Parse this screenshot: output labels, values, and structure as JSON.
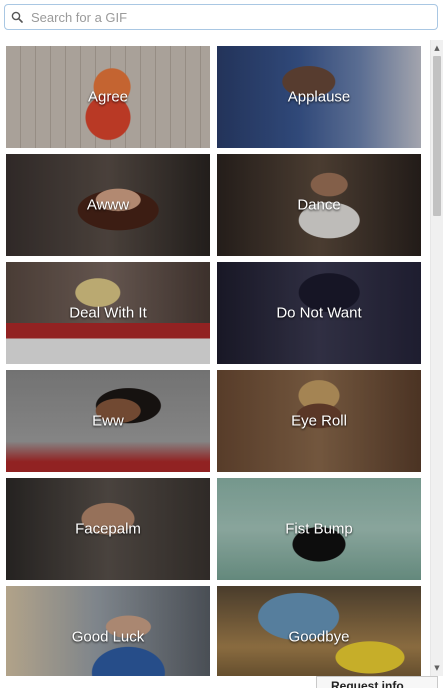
{
  "search": {
    "placeholder": "Search for a GIF",
    "value": ""
  },
  "icons": {
    "search": "search-icon",
    "scroll_up": "scroll-up-arrow",
    "scroll_down": "scroll-down-arrow"
  },
  "colors": {
    "search_border": "#a9c7e3",
    "label_text": "#ffffff",
    "scrollbar_thumb": "#c2c2c2"
  },
  "gifs": [
    {
      "label": "Agree"
    },
    {
      "label": "Applause"
    },
    {
      "label": "Awww"
    },
    {
      "label": "Dance"
    },
    {
      "label": "Deal With It"
    },
    {
      "label": "Do Not Want"
    },
    {
      "label": "Eww"
    },
    {
      "label": "Eye Roll"
    },
    {
      "label": "Facepalm"
    },
    {
      "label": "Fist Bump"
    },
    {
      "label": "Good Luck"
    },
    {
      "label": "Goodbye"
    }
  ],
  "footer": {
    "partial_button_text": "Request info"
  }
}
